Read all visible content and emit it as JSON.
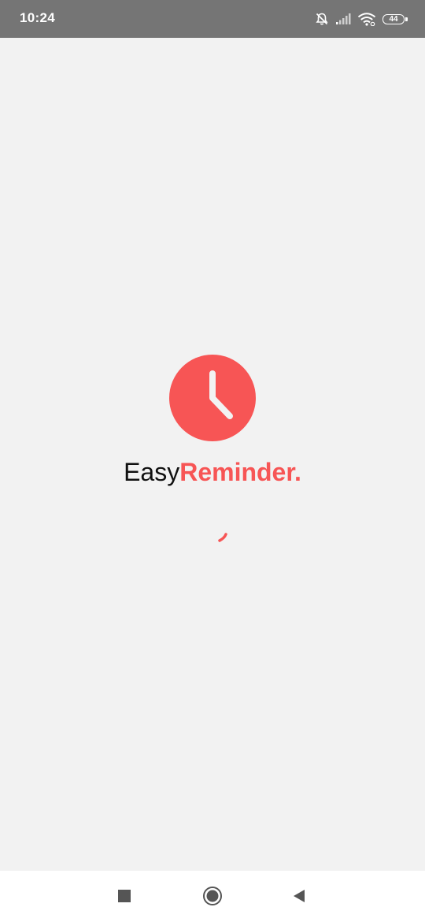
{
  "status_bar": {
    "time": "10:24",
    "battery_level": "44",
    "icons": [
      "notifications-off-icon",
      "signal-icon",
      "wifi-icon",
      "battery-icon"
    ]
  },
  "splash": {
    "brand_part1": "Easy",
    "brand_part2": "Reminder.",
    "logo_icon": "clock-icon",
    "loading_icon": "loading-spinner-icon"
  },
  "colors": {
    "accent": "#f75555",
    "background": "#f2f2f2",
    "status_bar": "#757575",
    "nav_icons": "#555555"
  },
  "nav_bar": {
    "buttons": [
      "recents-button",
      "home-button",
      "back-button"
    ]
  }
}
